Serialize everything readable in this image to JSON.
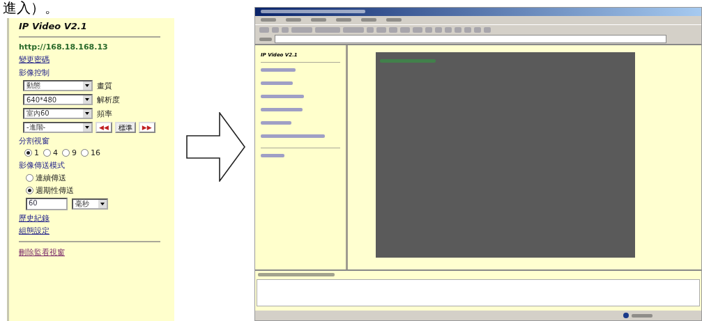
{
  "caption": "進入）。",
  "panel": {
    "title": "IP Video V2.1",
    "address": "http://168.18.168.13",
    "links_top": [
      "變更密碼"
    ],
    "section": "影像控制",
    "selects": [
      {
        "value": "動態",
        "label": "畫質"
      },
      {
        "value": "640*480",
        "label": "解析度"
      },
      {
        "value": "室內60",
        "label": "頻率"
      },
      {
        "value": "-進階-"
      }
    ],
    "buttons": [
      {
        "kind": "prev",
        "label": "◀◀"
      },
      {
        "kind": "text",
        "label": "標準"
      },
      {
        "kind": "next",
        "label": "▶▶"
      }
    ],
    "split_title": "分割視窗",
    "split_options": [
      {
        "label": "1",
        "selected": true
      },
      {
        "label": "4",
        "selected": false
      },
      {
        "label": "9",
        "selected": false
      },
      {
        "label": "16",
        "selected": false
      }
    ],
    "mode_title": "影像傳送模式",
    "mode_options": [
      {
        "label": "連續傳送",
        "selected": false
      },
      {
        "label": "週期性傳送",
        "selected": true
      }
    ],
    "interval": {
      "value": "60",
      "unit": "毫秒"
    },
    "links": [
      "歷史紀錄",
      "組態設定"
    ],
    "delete_link": "刪除監看視窗"
  },
  "browser": {
    "sidebar_title": "IP Video V2.1"
  }
}
